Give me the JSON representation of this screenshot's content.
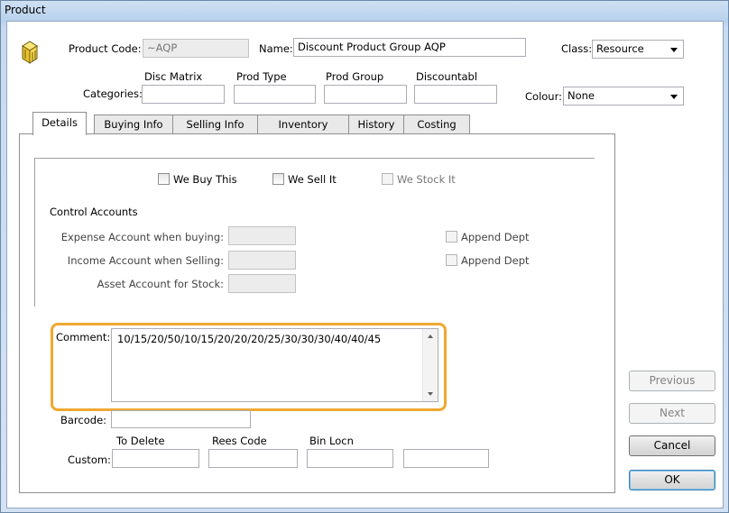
{
  "window": {
    "title": "Product"
  },
  "header": {
    "product_code_label": "Product Code:",
    "product_code_value": "~AQP",
    "name_label": "Name:",
    "name_value": "Discount Product Group AQP",
    "class_label": "Class:",
    "class_value": "Resource",
    "categories_label": "Categories:",
    "category_headers": [
      "Disc Matrix",
      "Prod Type",
      "Prod Group",
      "Discountabl"
    ],
    "category_values": [
      "",
      "",
      "",
      ""
    ],
    "colour_label": "Colour:",
    "colour_value": "None"
  },
  "tabs": [
    {
      "label": "Details",
      "active": true
    },
    {
      "label": "Buying Info",
      "active": false
    },
    {
      "label": "Selling Info",
      "active": false
    },
    {
      "label": "Inventory",
      "active": false
    },
    {
      "label": "History",
      "active": false
    },
    {
      "label": "Costing",
      "active": false
    }
  ],
  "details": {
    "we_buy_this": {
      "label": "We Buy This",
      "checked": false
    },
    "we_sell_it": {
      "label": "We Sell It",
      "checked": false
    },
    "we_stock_it": {
      "label": "We Stock It",
      "checked": false,
      "disabled": true
    },
    "control_accounts_title": "Control Accounts",
    "expense_label": "Expense Account when buying:",
    "income_label": "Income Account when Selling:",
    "asset_label": "Asset Account for Stock:",
    "append_dept_1": "Append Dept",
    "append_dept_2": "Append Dept",
    "comment_label": "Comment:",
    "comment_value": "10/15/20/50/10/15/20/20/20/25/30/30/30/40/40/45",
    "barcode_label": "Barcode:",
    "barcode_value": "",
    "custom_label": "Custom:",
    "custom_headers": [
      "To Delete",
      "Rees Code",
      "Bin Locn"
    ],
    "custom_values": [
      "",
      "",
      "",
      ""
    ]
  },
  "buttons": {
    "previous": "Previous",
    "next": "Next",
    "cancel": "Cancel",
    "ok": "OK"
  },
  "colors": {
    "highlight": "#f0a830",
    "icon_yellow": "#f5d53a"
  }
}
